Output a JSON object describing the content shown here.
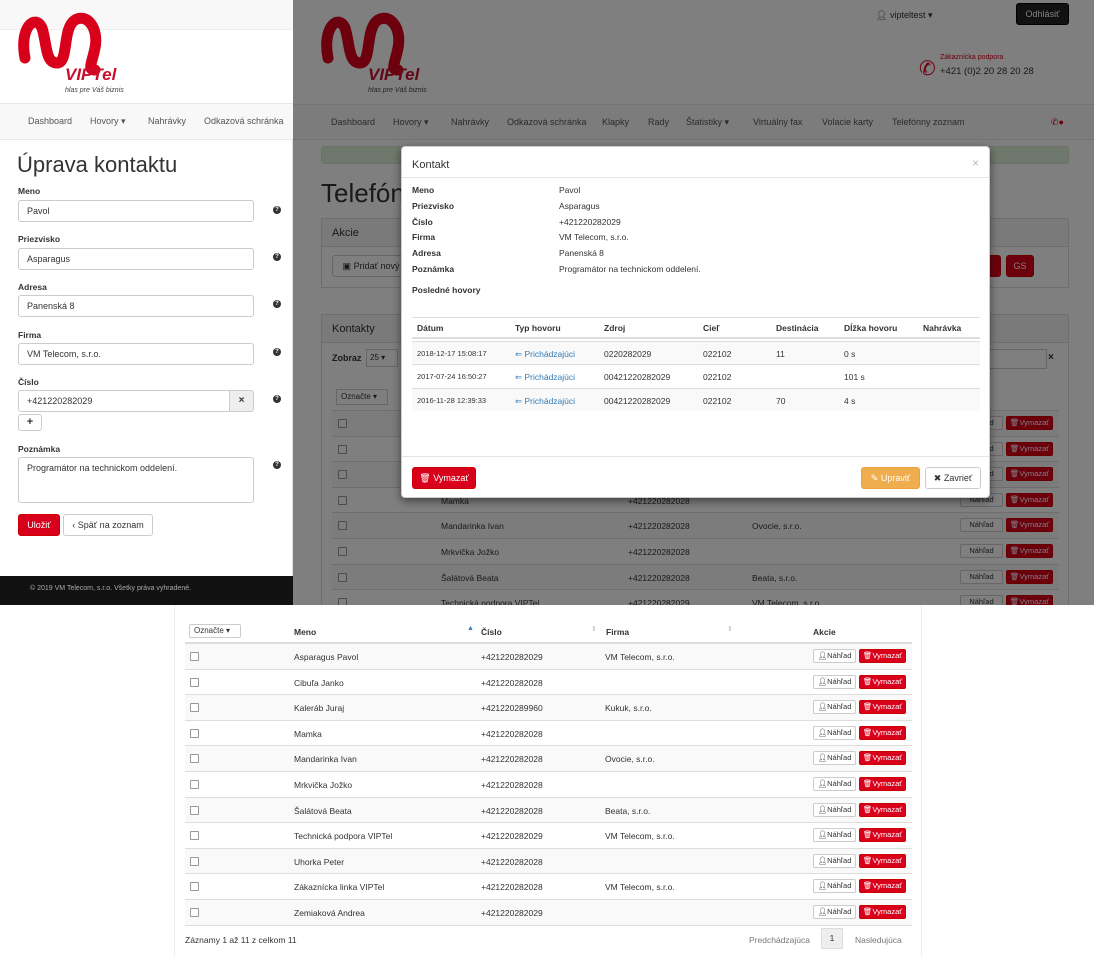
{
  "brand": {
    "logo_text": "VIPTel",
    "slogan": "hlas pre Váš biznis"
  },
  "header": {
    "user": "vipteltest",
    "logout": "Odhlásiť",
    "support_label": "Zákaznícka podpora",
    "support_phone": "+421 (0)2 20 28 20 28"
  },
  "main_nav": [
    "Dashboard",
    "Hovory",
    "Nahrávky",
    "Odkazová schránka",
    "Klapky",
    "Rady",
    "Štatistiky",
    "Virtuálny fax",
    "Volacie karty",
    "Telefónny zoznam"
  ],
  "left_nav": [
    "Dashboard",
    "Hovory",
    "Nahrávky",
    "Odkazová schránka"
  ],
  "bg_page": {
    "title": "Telefónny zoznam",
    "actions_title": "Akcie",
    "add_button": "Pridať nový",
    "gs_button": "GS",
    "contacts_title": "Kontakty",
    "show_label": "Zobraz",
    "show_value": "25",
    "mark_label": "Označte",
    "rows": [
      {
        "name": "Mamka",
        "number": "+421220282028",
        "company": ""
      },
      {
        "name": "Mandarinka Ivan",
        "number": "+421220282028",
        "company": "Ovocie, s.r.o."
      },
      {
        "name": "Mrkvička Jožko",
        "number": "+421220282028",
        "company": ""
      },
      {
        "name": "Šalátová Beata",
        "number": "+421220282028",
        "company": "Beata, s.r.o."
      },
      {
        "name": "Technická podpora VIPTel",
        "number": "+421220282029",
        "company": "VM Telecom, s.r.o."
      }
    ],
    "view_label": "Náhľad",
    "delete_label": "Vymazať"
  },
  "edit_form": {
    "title": "Úprava kontaktu",
    "first_name_label": "Meno",
    "first_name": "Pavol",
    "last_name_label": "Priezvisko",
    "last_name": "Asparagus",
    "address_label": "Adresa",
    "address": "Panenská 8",
    "company_label": "Firma",
    "company": "VM Telecom, s.r.o.",
    "number_label": "Číslo",
    "number": "+421220282029",
    "note_label": "Poznámka",
    "note": "Programátor na technickom oddelení.",
    "save": "Uložiť",
    "back": "Späť na zoznam",
    "footer": "© 2019 VM Telecom, s.r.o. Všetky práva vyhradené."
  },
  "modal": {
    "title": "Kontakt",
    "close": "×",
    "fields": [
      {
        "label": "Meno",
        "value": "Pavol"
      },
      {
        "label": "Priezvisko",
        "value": "Asparagus"
      },
      {
        "label": "Číslo",
        "value": "+421220282029"
      },
      {
        "label": "Firma",
        "value": "VM Telecom, s.r.o."
      },
      {
        "label": "Adresa",
        "value": "Panenská 8"
      },
      {
        "label": "Poznámka",
        "value": "Programátor na technickom oddelení."
      }
    ],
    "last_calls_label": "Posledné hovory",
    "columns": [
      "Dátum",
      "Typ hovoru",
      "Zdroj",
      "Cieľ",
      "Destinácia",
      "Dĺžka hovoru",
      "Nahrávka"
    ],
    "calls": [
      {
        "date": "2018-12-17 15:08:17",
        "type": "Prichádzajúci",
        "source": "0220282029",
        "target": "022102",
        "destination": "11",
        "duration": "0 s"
      },
      {
        "date": "2017-07-24 16:50:27",
        "type": "Prichádzajúci",
        "source": "00421220282029",
        "target": "022102",
        "destination": "",
        "duration": "101 s"
      },
      {
        "date": "2016-11-28 12:39:33",
        "type": "Prichádzajúci",
        "source": "00421220282029",
        "target": "022102",
        "destination": "70",
        "duration": "4 s"
      }
    ],
    "delete": "Vymazať",
    "edit": "Upraviť",
    "close_btn": "Zavrieť"
  },
  "contacts_table": {
    "mark_label": "Označte",
    "columns": [
      "Meno",
      "Číslo",
      "Firma",
      "Akcie"
    ],
    "rows": [
      {
        "name": "Asparagus Pavol",
        "number": "+421220282029",
        "company": "VM Telecom, s.r.o."
      },
      {
        "name": "Cibuľa Janko",
        "number": "+421220282028",
        "company": ""
      },
      {
        "name": "Kaleráb Juraj",
        "number": "+421220289960",
        "company": "Kukuk, s.r.o."
      },
      {
        "name": "Mamka",
        "number": "+421220282028",
        "company": ""
      },
      {
        "name": "Mandarinka Ivan",
        "number": "+421220282028",
        "company": "Ovocie, s.r.o."
      },
      {
        "name": "Mrkvička Jožko",
        "number": "+421220282028",
        "company": ""
      },
      {
        "name": "Šalátová Beata",
        "number": "+421220282028",
        "company": "Beata, s.r.o."
      },
      {
        "name": "Technická podpora VIPTel",
        "number": "+421220282029",
        "company": "VM Telecom, s.r.o."
      },
      {
        "name": "Uhorka Peter",
        "number": "+421220282028",
        "company": ""
      },
      {
        "name": "Zákaznícka linka VIPTel",
        "number": "+421220282028",
        "company": "VM Telecom, s.r.o."
      },
      {
        "name": "Zemiaková Andrea",
        "number": "+421220282029",
        "company": ""
      }
    ],
    "view_label": "Náhľad",
    "delete_label": "Vymazať",
    "summary": "Záznamy 1 až 11 z celkom 11",
    "prev": "Predchádzajúca",
    "page": "1",
    "next": "Nasledujúca"
  },
  "colors": {
    "brand_red": "#d9001b",
    "warning": "#f0ad4e"
  }
}
